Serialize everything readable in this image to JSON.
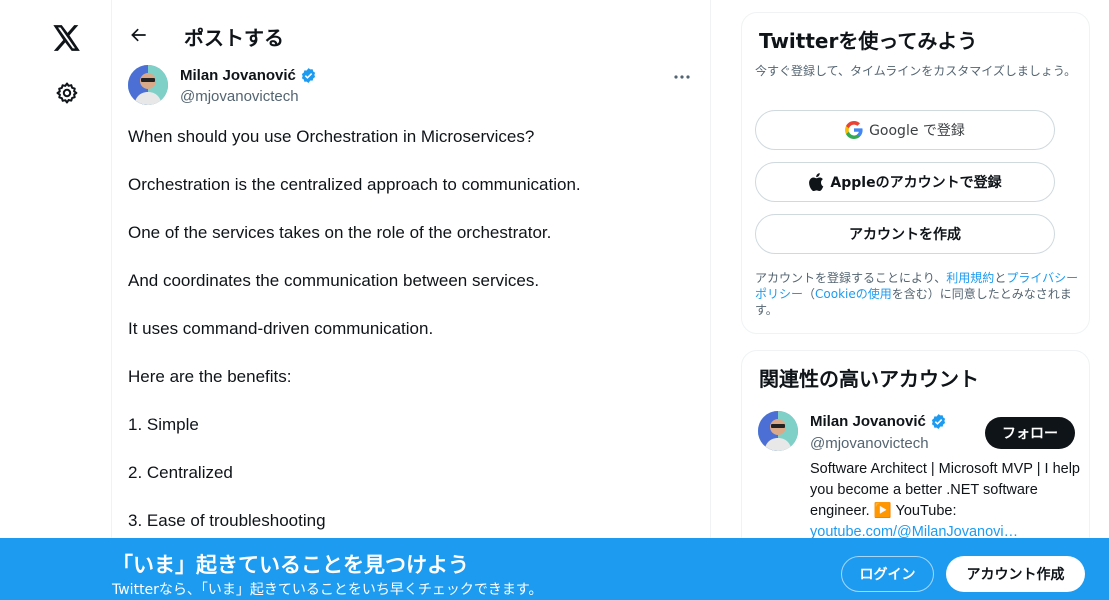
{
  "nav": {
    "logo_icon": "x-logo-icon",
    "settings_icon": "gear-icon"
  },
  "header": {
    "title": "ポストする",
    "back_icon": "arrow-left-icon"
  },
  "post": {
    "author_name": "Milan Jovanović",
    "author_handle": "@mjovanovictech",
    "verified_icon": "verified-badge-icon",
    "more_icon": "more-horizontal-icon",
    "lines": [
      "When should you use Orchestration in Microservices?",
      "Orchestration is the centralized approach to communication.",
      "One of the services takes on the role of the orchestrator.",
      "And coordinates the communication between services.",
      "It uses command-driven communication.",
      "Here are the benefits:",
      "1. Simple",
      "2. Centralized",
      "3. Ease of troubleshooting"
    ]
  },
  "signup_card": {
    "title": "Twitterを使ってみよう",
    "subtitle": "今すぐ登録して、タイムラインをカスタマイズしましょう。",
    "google_label": "Google で登録",
    "apple_label": "Appleのアカウントで登録",
    "create_label": "アカウントを作成",
    "terms_prefix": "アカウントを登録することにより、",
    "terms_link": "利用規約",
    "terms_and": "と",
    "privacy_link": "プライバシーポリシー",
    "paren_open": "（",
    "cookie_link": "Cookieの使用",
    "terms_suffix": "を含む）に同意したとみなされます。"
  },
  "related": {
    "title": "関連性の高いアカウント",
    "name": "Milan Jovanović",
    "handle": "@mjovanovictech",
    "follow_label": "フォロー",
    "bio": "Software Architect | Microsoft MVP | I help you become a better .NET software engineer. ▶️ YouTube:",
    "bio_link": "youtube.com/@MilanJovanovi…"
  },
  "banner": {
    "title": "「いま」起きていることを見つけよう",
    "subtitle": "Twitterなら、「いま」起きていることをいち早くチェックできます。",
    "login_label": "ログイン",
    "signup_label": "アカウント作成"
  },
  "colors": {
    "accent": "#1d9bf0",
    "text": "#0f1419",
    "muted": "#536471"
  }
}
